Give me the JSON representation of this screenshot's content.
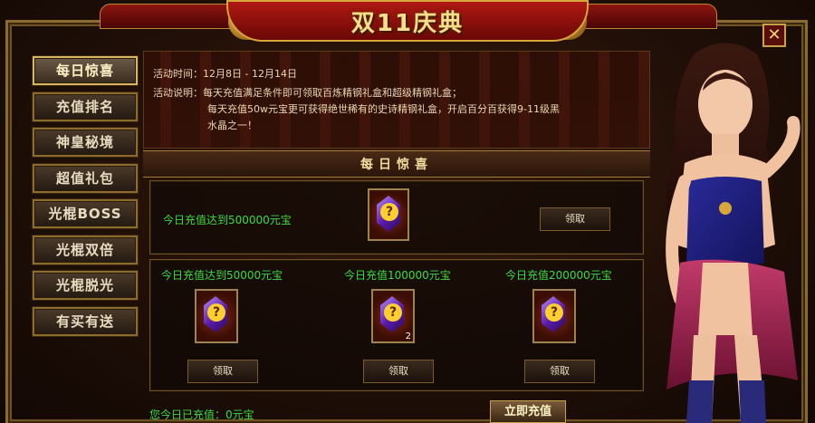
{
  "header": {
    "title": "双11庆典"
  },
  "sidebar": {
    "items": [
      {
        "label": "每日惊喜"
      },
      {
        "label": "充值排名"
      },
      {
        "label": "神皇秘境"
      },
      {
        "label": "超值礼包"
      },
      {
        "label": "光棍BOSS"
      },
      {
        "label": "光棍双倍"
      },
      {
        "label": "光棍脱光"
      },
      {
        "label": "有买有送"
      }
    ]
  },
  "info": {
    "time_label": "活动时间：",
    "time_value": "12月8日 - 12月14日",
    "desc_label": "活动说明：",
    "desc_line1": "每天充值满足条件即可领取百炼精钢礼盒和超级精钢礼盒；",
    "desc_line2": "每天充值50w元宝更可获得绝世稀有的史诗精钢礼盒，开启百分百获得9-11级黑",
    "desc_line3": "水晶之一！"
  },
  "section": {
    "title": "每日惊喜"
  },
  "rewards": {
    "top": {
      "condition": "今日充值达到500000元宝",
      "claim": "领取"
    },
    "tiers": [
      {
        "condition": "今日充值达到50000元宝",
        "claim": "领取",
        "count": ""
      },
      {
        "condition": "今日充值100000元宝",
        "claim": "领取",
        "count": "2"
      },
      {
        "condition": "今日充值200000元宝",
        "claim": "领取",
        "count": ""
      }
    ]
  },
  "footer": {
    "status": "您今日已充值：0元宝",
    "recharge_button": "立即充值"
  },
  "colors": {
    "accent_gold": "#d8b560",
    "green_text": "#3cdc3c",
    "banner_red": "#b01812"
  },
  "icons": {
    "close": "close-icon",
    "gem": "mystery-gem-icon"
  }
}
